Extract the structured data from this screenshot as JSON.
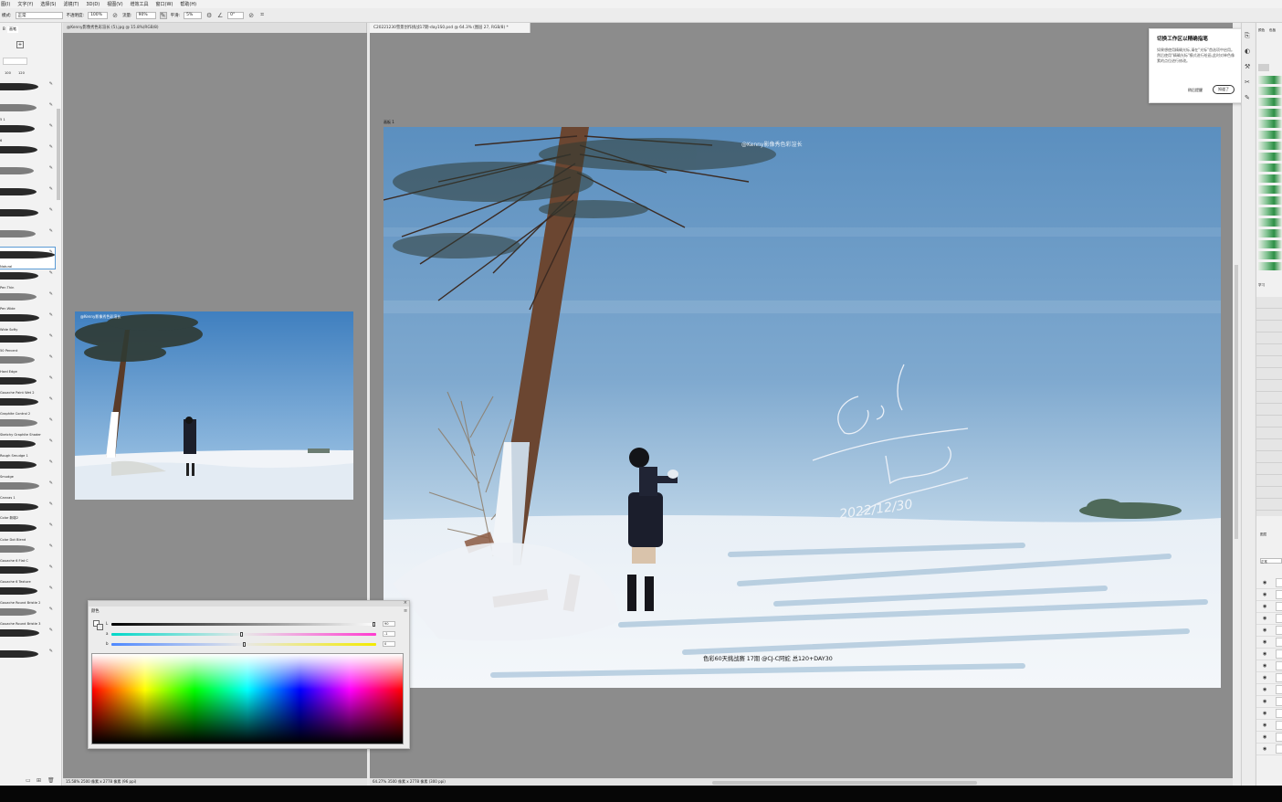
{
  "menu": [
    "图(I)",
    "文字(Y)",
    "选择(S)",
    "滤镜(T)",
    "3D(D)",
    "视图(V)",
    "增效工具",
    "窗口(W)",
    "帮助(H)"
  ],
  "options": {
    "mode_label": "模式:",
    "mode_value": "正常",
    "opacity_label": "不透明度:",
    "opacity_value": "100%",
    "flow_label": "流量:",
    "flow_value": "90%",
    "smooth_label": "平滑:",
    "smooth_value": "5%",
    "angle_value": "0°"
  },
  "left_panel": {
    "tabs": [
      "B",
      "画笔"
    ],
    "size_values": [
      "100",
      "120"
    ],
    "brushes": [
      {
        "name": ""
      },
      {
        "name": "5 1"
      },
      {
        "name": "6"
      },
      {
        "name": ""
      },
      {
        "name": ""
      },
      {
        "name": ""
      },
      {
        "name": ""
      },
      {
        "name": ""
      },
      {
        "name": "Natural"
      },
      {
        "name": "Pen Thin"
      },
      {
        "name": "Pen Wide"
      },
      {
        "name": "Wide Softy"
      },
      {
        "name": "50 Percent"
      },
      {
        "name": "Hard Edge"
      },
      {
        "name": "Gouache Paint Wet 2"
      },
      {
        "name": "Graphite Control 2"
      },
      {
        "name": "Sketchy Graphite Shader"
      },
      {
        "name": "Rough Smudge 1"
      },
      {
        "name": "Smudge"
      },
      {
        "name": "Canvas 1"
      },
      {
        "name": "Color 新增2"
      },
      {
        "name": "Color Dot Blend"
      },
      {
        "name": "Gouache 6 Flat C"
      },
      {
        "name": "Gouache 6 Texture"
      },
      {
        "name": "Gouache Round Bristle 2"
      },
      {
        "name": "Gouache Round Bristle 3"
      },
      {
        "name": ""
      },
      {
        "name": ""
      }
    ]
  },
  "ref_doc": {
    "tab": "@Kenny影像秀色彩渲长 (5).jpg @ 15.8%(RGB/8)",
    "watermark": "@Kenny影像秀色彩渲长",
    "status": "15.58%  2500 像素 x 2778 像素 (96 ppi)"
  },
  "main_doc": {
    "tab": "C20221230雪景创作挑战17期-day1S0.psd @ 64.3% (图层 27, RGB/8) *",
    "artboard": "画板 1",
    "watermark": "@Kenny影像秀色彩渲长",
    "caption": "色彩60天挑战赛 17期 @CJ-C阿蛇  总120+DAY30",
    "signature": "C.J.C Tony 2022/12/30",
    "status": "64.27%  3500 像素 x 2778 像素 (300 ppi)"
  },
  "tooltip": {
    "title": "切换工作区以精确指笔",
    "body": "如果想使用精确光标,请在\"光标\"首选项中启用。然后使用\"精确光标\"模式进行绘画,此时对单色像素的点位进行修改。",
    "later": "稍后提醒",
    "ok": "知道了"
  },
  "color_panel": {
    "tab": "颜色",
    "sliders": [
      {
        "label": "L",
        "value": "90",
        "knob": 0.99
      },
      {
        "label": "a",
        "value": "-1",
        "knob": 0.49
      },
      {
        "label": "b",
        "value": "0",
        "knob": 0.5
      }
    ]
  },
  "right_panel": {
    "tabs": [
      "颜色",
      "色板"
    ],
    "labels": [
      "学习",
      "图层",
      "正常"
    ]
  }
}
